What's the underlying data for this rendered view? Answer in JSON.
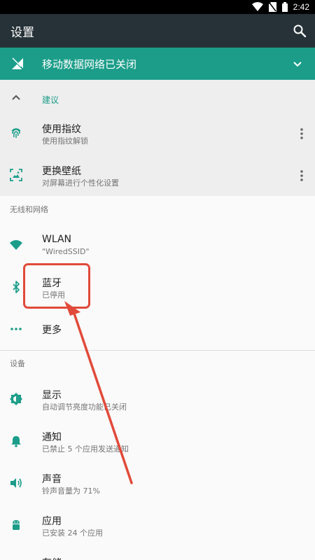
{
  "status_bar": {
    "time": "2:42"
  },
  "app_bar": {
    "title": "设置",
    "search_icon": "search-icon"
  },
  "banner": {
    "text": "移动数据网络已关闭",
    "icon": "signal-off-icon"
  },
  "suggestions": {
    "header": "建议",
    "items": [
      {
        "title": "使用指纹",
        "subtitle": "使用指纹解锁",
        "icon": "fingerprint-icon"
      },
      {
        "title": "更换壁纸",
        "subtitle": "对屏幕进行个性化设置",
        "icon": "wallpaper-icon"
      }
    ]
  },
  "wireless": {
    "header": "无线和网络",
    "items": [
      {
        "title": "WLAN",
        "subtitle": "\"WiredSSID\"",
        "icon": "wifi-icon"
      },
      {
        "title": "蓝牙",
        "subtitle": "已停用",
        "icon": "bluetooth-icon"
      },
      {
        "title": "更多",
        "icon": "more-horiz-icon"
      }
    ]
  },
  "device": {
    "header": "设备",
    "items": [
      {
        "title": "显示",
        "subtitle": "自动调节亮度功能已关闭",
        "icon": "brightness-icon"
      },
      {
        "title": "通知",
        "subtitle": "已禁止 5 个应用发送通知",
        "icon": "bell-icon"
      },
      {
        "title": "声音",
        "subtitle": "铃声音量为 71%",
        "icon": "volume-icon"
      },
      {
        "title": "应用",
        "subtitle": "已安装 24 个应用",
        "icon": "android-icon"
      },
      {
        "title": "存储",
        "icon": "storage-icon"
      }
    ]
  },
  "colors": {
    "accent": "#1b9d89",
    "app_bar": "#263238",
    "annotation": "#e14a3a"
  }
}
